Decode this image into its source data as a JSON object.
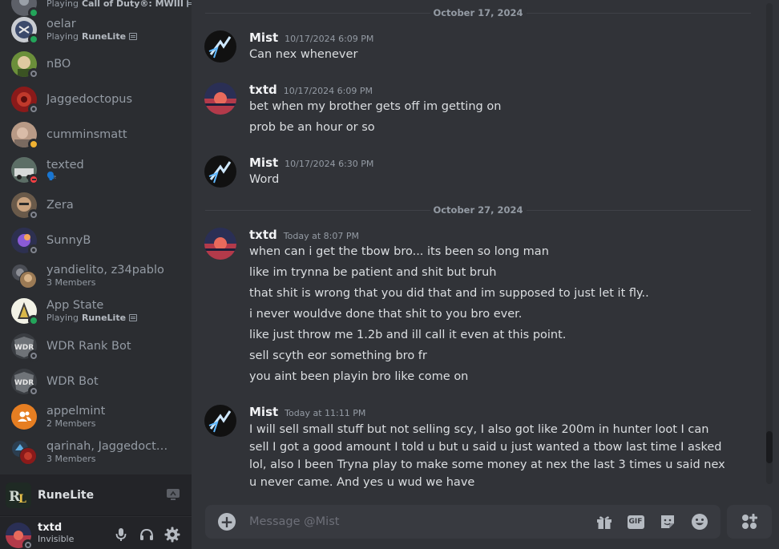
{
  "dm_list": [
    {
      "name": "",
      "sub_prefix": "Playing",
      "sub_game": "Call of Duty®: MWIII",
      "status": "online"
    },
    {
      "name": "oelar",
      "sub_prefix": "Playing",
      "sub_game": "RuneLite",
      "status": "online"
    },
    {
      "name": "nBO",
      "status": "offline"
    },
    {
      "name": "Jaggedoctopus",
      "status": "offline"
    },
    {
      "name": "cumminsmatt",
      "status": "idle"
    },
    {
      "name": "texted",
      "sub_emoji": "🗣️",
      "status": "dnd"
    },
    {
      "name": "Zera",
      "status": "offline"
    },
    {
      "name": "SunnyB",
      "status": "offline"
    },
    {
      "name": "yandielito, z34pablo",
      "sub_text": "3 Members"
    },
    {
      "name": "App State",
      "sub_prefix": "Playing",
      "sub_game": "RuneLite",
      "status": "online"
    },
    {
      "name": "WDR Rank Bot",
      "status": "offline"
    },
    {
      "name": "WDR Bot",
      "status": "offline"
    },
    {
      "name": "appelmint",
      "sub_text": "2 Members"
    },
    {
      "name": "qarinah, Jaggedoctopus, ...",
      "sub_text": "3 Members"
    }
  ],
  "activity": {
    "name": "RuneLite"
  },
  "user": {
    "name": "txtd",
    "status": "Invisible"
  },
  "chat": {
    "dividers": [
      "October 17, 2024",
      "October 27, 2024"
    ],
    "messages": [
      {
        "author": "Mist",
        "time": "10/17/2024 6:09 PM",
        "lines": [
          "Can nex whenever"
        ]
      },
      {
        "author": "txtd",
        "time": "10/17/2024 6:09 PM",
        "lines": [
          "bet when my brother gets off im getting on",
          "prob be an hour or so"
        ]
      },
      {
        "author": "Mist",
        "time": "10/17/2024 6:30 PM",
        "lines": [
          "Word"
        ]
      },
      {
        "author": "txtd",
        "time": "Today at 8:07 PM",
        "lines": [
          "when can i get the tbow bro... its been so long man",
          "like im trynna be patient and shit but bruh",
          "that shit is wrong that you did that and im supposed to just let it fly..",
          "i never wouldve done that shit to you bro ever.",
          "like just throw me 1.2b and ill call it even at this point.",
          "sell scyth eor something bro fr",
          "you aint been playin bro like come on"
        ]
      },
      {
        "author": "Mist",
        "time": "Today at 11:11 PM",
        "paragraph": "I will sell small stuff but not selling scy, I also got like 200m in hunter loot I can sell I got a good amount I told u but u said u just wanted a tbow last time I asked lol, also I been Tryna play to make some money at nex  the last 3 times u said nex u never came. And yes u wud we have"
      }
    ]
  },
  "composer": {
    "placeholder": "Message @Mist",
    "gif_label": "GIF"
  },
  "colors": {
    "bg": "#313338",
    "sidebar": "#2b2d31",
    "panel": "#232428",
    "online": "#23a55a",
    "idle": "#f0b232",
    "dnd": "#f23f43",
    "offline": "#80848e",
    "appelmint": "#e67e22"
  }
}
